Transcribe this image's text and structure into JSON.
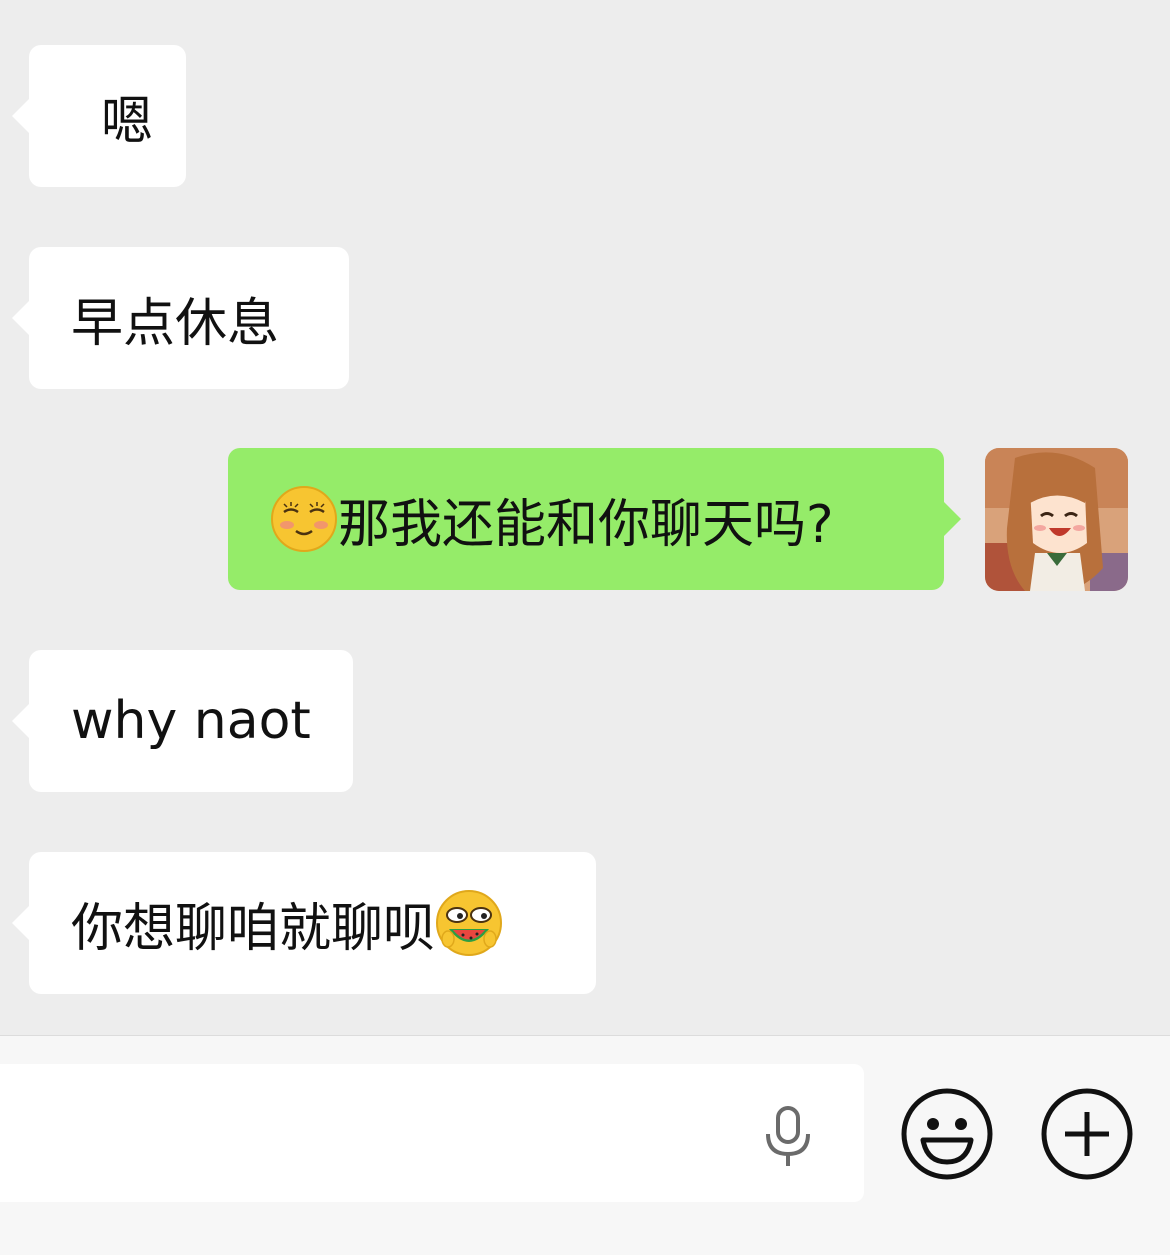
{
  "messages": [
    {
      "id": "m1",
      "side": "incoming",
      "text": "嗯"
    },
    {
      "id": "m2",
      "side": "incoming",
      "text": "早点休息"
    },
    {
      "id": "m3",
      "side": "outgoing",
      "emoji_before": "shy-smiling-face-emoji",
      "text": "那我还能和你聊天吗?"
    },
    {
      "id": "m4",
      "side": "incoming",
      "text": "why naot"
    },
    {
      "id": "m5",
      "side": "incoming",
      "text": "你想聊咱就聊呗",
      "emoji_after": "eating-watermelon-emoji"
    }
  ],
  "avatar": {
    "icon": "anime-girl-avatar"
  },
  "input_bar": {
    "value": "",
    "voice_icon": "microphone-icon",
    "emoji_icon": "smiley-face-icon",
    "more_icon": "plus-icon"
  },
  "colors": {
    "background": "#ededed",
    "incoming_bubble": "#ffffff",
    "outgoing_bubble": "#95ec69",
    "input_bar": "#f7f7f7"
  }
}
